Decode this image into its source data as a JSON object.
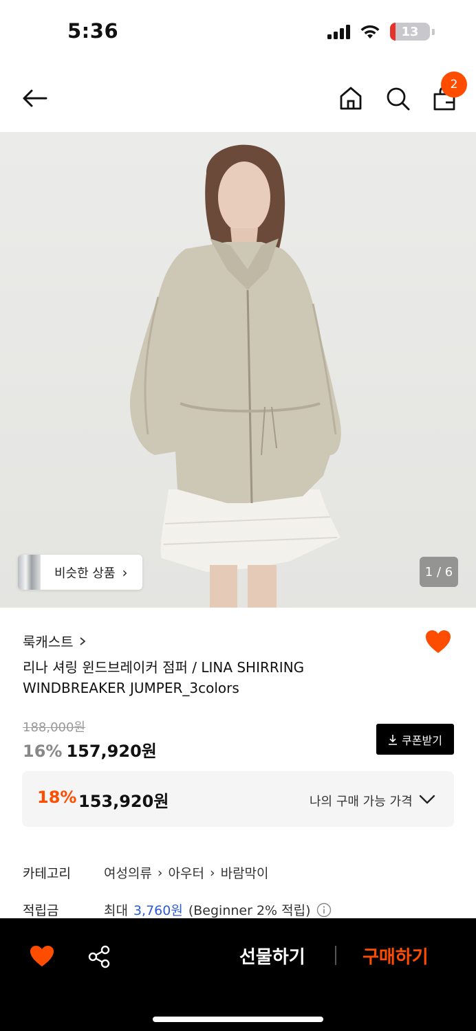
{
  "status_bar": {
    "time": "5:36",
    "battery": "13",
    "battery_fraction": 0.13,
    "icons": [
      "signal-icon",
      "wifi-icon",
      "battery-icon"
    ]
  },
  "nav": {
    "cart_count": "2",
    "icons": [
      "back-arrow-icon",
      "home-icon",
      "search-icon",
      "cart-icon"
    ]
  },
  "gallery": {
    "similar_label": "비슷한 상품",
    "counter": "1 / 6"
  },
  "product": {
    "brand": "룩캐스트",
    "name": "리나 셔링 윈드브레이커 점퍼 / LINA SHIRRING WINDBREAKER JUMPER_3colors",
    "original_price": "188,000원",
    "sale_rate": "16%",
    "sale_price": "157,920원",
    "coupon_label": "쿠폰받기",
    "wished": true
  },
  "my_price": {
    "rate": "18%",
    "amount": "153,920원",
    "label": "나의 구매 가능 가격"
  },
  "info": {
    "category_key": "카테고리",
    "category_path": [
      "여성의류",
      "아우터",
      "바람막이"
    ],
    "points_key": "적립금",
    "points_prefix": "최대",
    "points_amount": "3,760원",
    "points_suffix": "(Beginner 2% 적립)"
  },
  "bottom_bar": {
    "gift_label": "선물하기",
    "buy_label": "구매하기",
    "icons": [
      "heart-icon",
      "share-icon"
    ]
  },
  "colors": {
    "accent": "#ff4d00",
    "points_link": "#2c5bd9",
    "wish_heart": "#ff4d00"
  }
}
